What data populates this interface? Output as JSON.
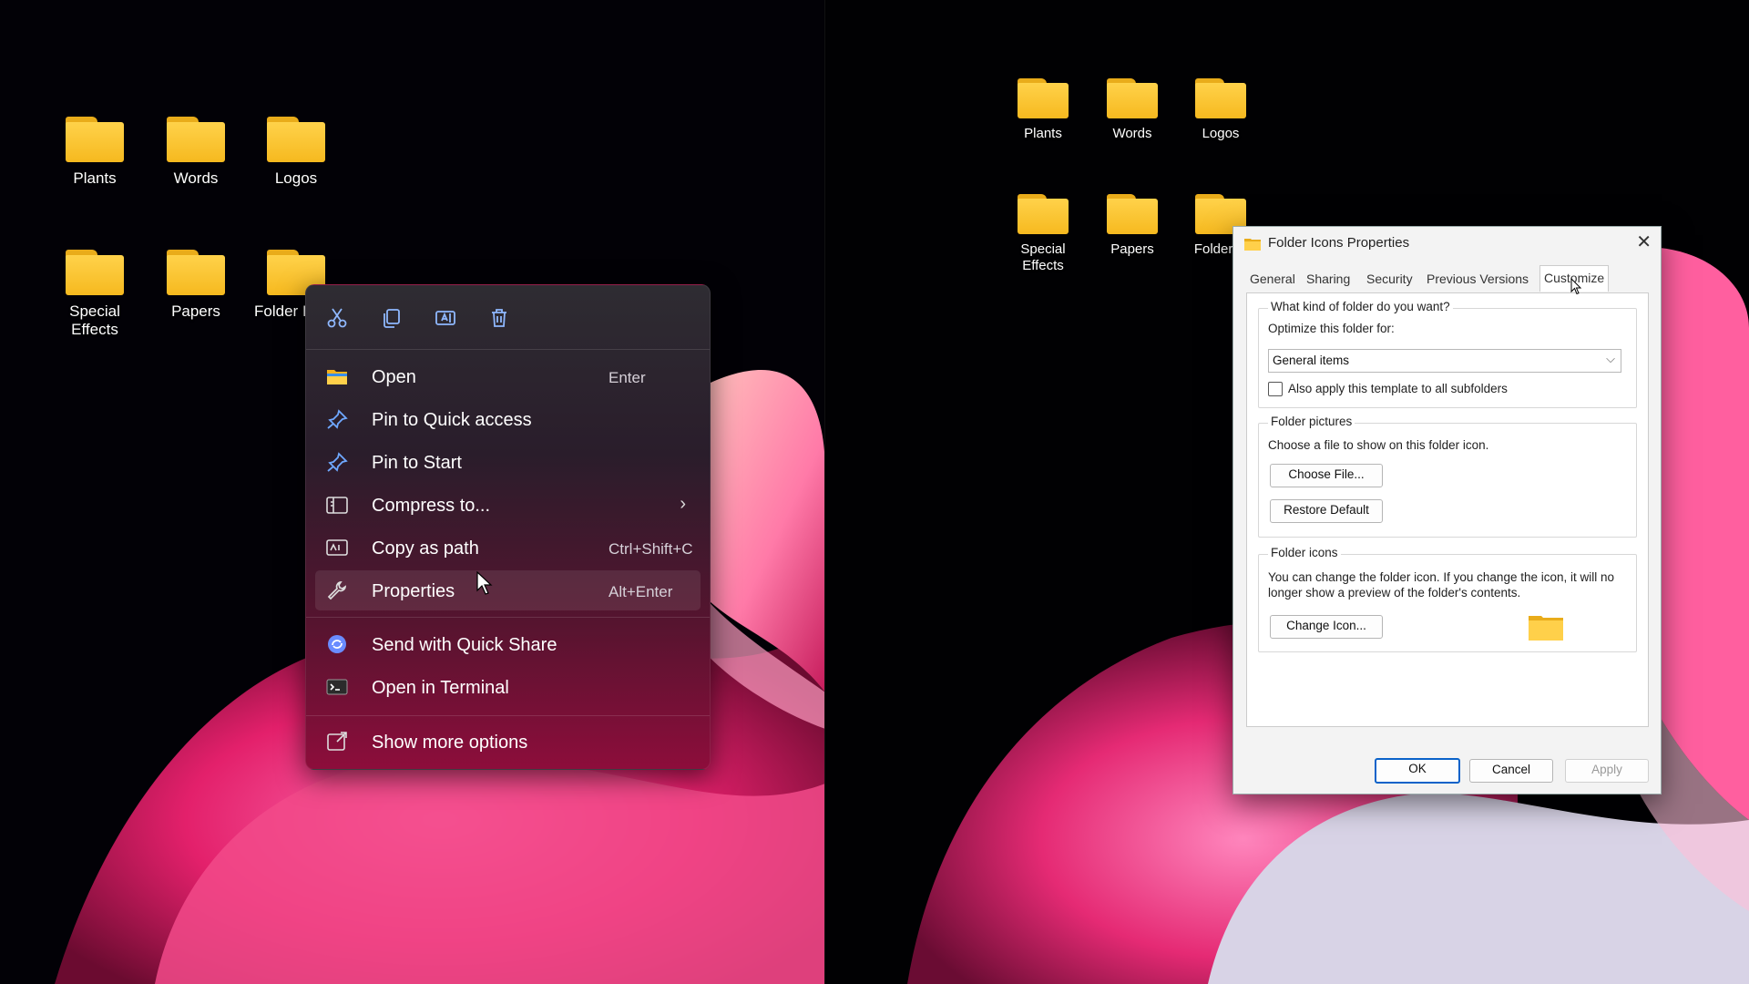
{
  "left_desktop": {
    "icons": [
      {
        "label": "Plants"
      },
      {
        "label": "Words"
      },
      {
        "label": "Logos"
      },
      {
        "label": "Special\nEffects"
      },
      {
        "label": "Papers"
      },
      {
        "label": "Folder I"
      }
    ]
  },
  "context_menu": {
    "quick_actions": [
      "cut-icon",
      "copy-icon",
      "rename-icon",
      "delete-icon"
    ],
    "items": [
      {
        "label": "Open",
        "shortcut": "Enter",
        "icon": "folder-icon"
      },
      {
        "label": "Pin to Quick access",
        "shortcut": "",
        "icon": "pin-icon"
      },
      {
        "label": "Pin to Start",
        "shortcut": "",
        "icon": "pin-icon"
      },
      {
        "label": "Compress to...",
        "shortcut": "",
        "icon": "compress-icon",
        "submenu_arrow": "›"
      },
      {
        "label": "Copy as path",
        "shortcut": "Ctrl+Shift+C",
        "icon": "copy-path-icon"
      },
      {
        "label": "Properties",
        "shortcut": "Alt+Enter",
        "icon": "wrench-icon"
      },
      {
        "label": "Send with Quick Share",
        "shortcut": "",
        "icon": "quick-share-icon"
      },
      {
        "label": "Open in Terminal",
        "shortcut": "",
        "icon": "terminal-icon"
      },
      {
        "label": "Show more options",
        "shortcut": "",
        "icon": "more-options-icon"
      }
    ]
  },
  "right_desktop": {
    "icons": [
      {
        "label": "Plants"
      },
      {
        "label": "Words"
      },
      {
        "label": "Logos"
      },
      {
        "label": "Special\nEffects"
      },
      {
        "label": "Papers"
      },
      {
        "label": "Folder Ic"
      }
    ]
  },
  "dialog": {
    "title": "Folder Icons Properties",
    "close": "✕",
    "tabs": [
      "General",
      "Sharing",
      "Security",
      "Previous Versions",
      "Customize"
    ],
    "active_tab": "Customize",
    "group1": {
      "title": "What kind of folder do you want?",
      "optimize_label": "Optimize this folder for:",
      "optimize_value": "General items",
      "subfolders_label": "Also apply this template to all subfolders"
    },
    "group2": {
      "title": "Folder pictures",
      "desc": "Choose a file to show on this folder icon.",
      "choose_file": "Choose File...",
      "restore_default": "Restore Default"
    },
    "group3": {
      "title": "Folder icons",
      "desc": "You can change the folder icon. If you change the icon, it will no longer show a preview of the folder's contents.",
      "change_icon": "Change Icon..."
    },
    "buttons": {
      "ok": "OK",
      "cancel": "Cancel",
      "apply": "Apply"
    }
  },
  "colors": {
    "folder_yellow": "#f6b91f",
    "accent_blue": "#0a62c9",
    "menu_pink": "#8d0d3b"
  }
}
